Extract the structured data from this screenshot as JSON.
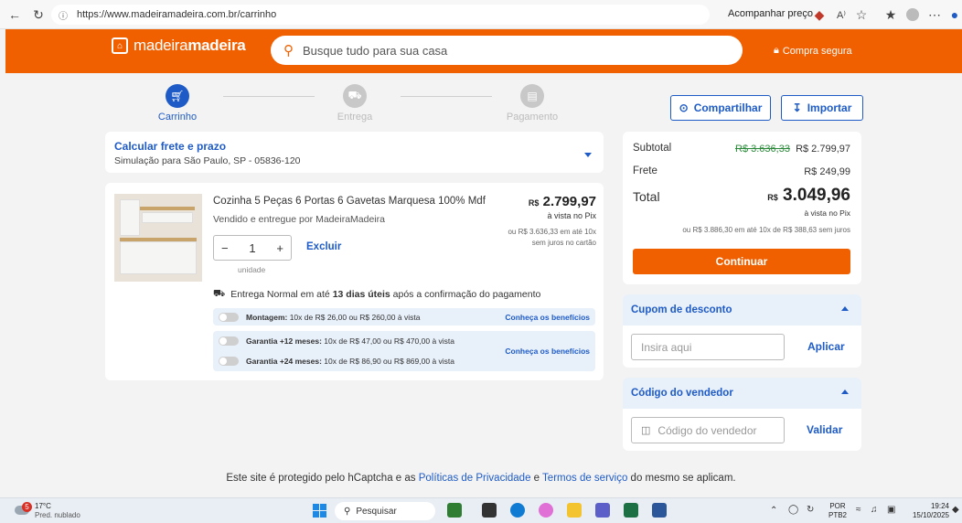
{
  "browser": {
    "url": "https://www.madeiramadeira.com.br/carrinho",
    "track_label": "Acompanhar preço"
  },
  "header": {
    "logo_light": "madeira",
    "logo_bold": "madeira",
    "search_placeholder": "Busque tudo para sua casa",
    "secure_label": "Compra segura",
    "brand_color": "#f06000"
  },
  "steps": [
    {
      "label": "Carrinho",
      "state": "active"
    },
    {
      "label": "Entrega",
      "state": "inactive"
    },
    {
      "label": "Pagamento",
      "state": "inactive"
    }
  ],
  "actions": {
    "share_label": "Compartilhar",
    "import_label": "Importar"
  },
  "frete": {
    "title": "Calcular frete e prazo",
    "subtitle": "Simulação para São Paulo, SP - 05836-120"
  },
  "product": {
    "name": "Cozinha 5 Peças 6 Portas 6 Gavetas Marquesa 100% Mdf",
    "seller_prefix": "Vendido e entregue por ",
    "seller": "MadeiraMadeira",
    "currency": "R$",
    "price": "2.799,97",
    "pix_note": "à vista no Pix",
    "installments_line1": "ou R$ 3.636,33 em até 10x",
    "installments_line2": "sem juros no cartão",
    "quantity": "1",
    "quantity_unit": "unidade",
    "remove_label": "Excluir",
    "delivery_prefix": "Entrega Normal em até ",
    "delivery_days": "13 dias úteis",
    "delivery_suffix": " após a confirmação do pagamento"
  },
  "services": [
    {
      "title": "Montagem:",
      "detail": " 10x de R$ 26,00 ou R$ 260,00 à vista"
    },
    {
      "title": "Garantia +12 meses:",
      "detail": " 10x de R$ 47,00 ou R$ 470,00 à vista"
    },
    {
      "title": "Garantia +24 meses:",
      "detail": " 10x de R$ 86,90 ou R$ 869,00 à vista"
    }
  ],
  "services_link": "Conheça os benefícios",
  "summary": {
    "subtotal_label": "Subtotal",
    "subtotal_old": "R$ 3.636,33",
    "subtotal_new": "R$ 2.799,97",
    "frete_label": "Frete",
    "frete_value": "R$ 249,99",
    "total_label": "Total",
    "total_currency": "R$",
    "total_value": "3.049,96",
    "total_pix": "à vista no Pix",
    "total_installments": "ou R$ 3.886,30 em até 10x de R$ 388,63 sem juros",
    "continue_label": "Continuar"
  },
  "coupon": {
    "title": "Cupom de desconto",
    "placeholder": "Insira aqui",
    "apply_label": "Aplicar"
  },
  "seller_code": {
    "title": "Código do vendedor",
    "placeholder": "Código do vendedor",
    "validate_label": "Validar"
  },
  "footer": {
    "prefix": "Este site é protegido pelo hCaptcha e as ",
    "privacy": "Políticas de Privacidade",
    "and": " e ",
    "terms": "Termos de serviço",
    "suffix": " do mesmo se aplicam."
  },
  "taskbar": {
    "temp": "17°C",
    "weather": "Pred. nublado",
    "weather_badge": "5",
    "search_label": "Pesquisar",
    "lang1": "POR",
    "lang2": "PTB2",
    "time": "19:24",
    "date": "15/10/2025"
  }
}
